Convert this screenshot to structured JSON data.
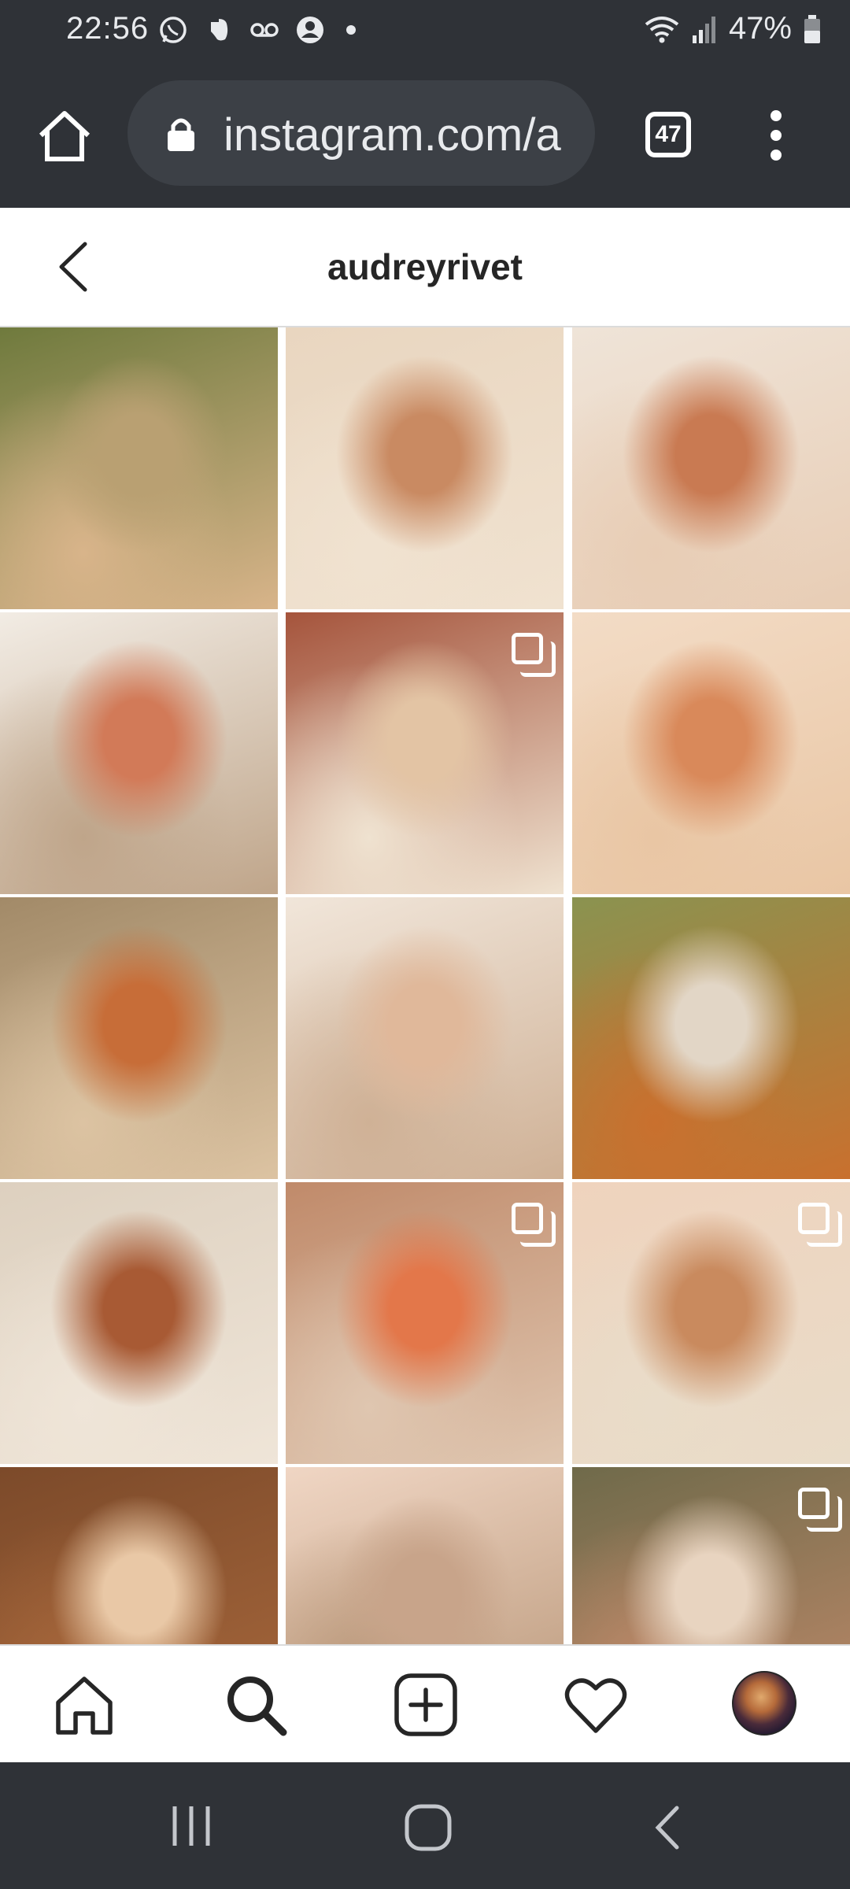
{
  "status_bar": {
    "time": "22:56",
    "battery": "47%",
    "left_icons": [
      "whatsapp-icon",
      "evernote-icon",
      "voicemail-icon",
      "account-icon",
      "dot-icon"
    ],
    "right_icons": [
      "wifi-icon",
      "signal-icon",
      "battery-icon"
    ]
  },
  "browser": {
    "url": "instagram.com/a",
    "tab_count": "47"
  },
  "profile": {
    "username": "audreyrivet"
  },
  "grid": {
    "posts": [
      {
        "multi": false,
        "colors": [
          "#6f7a3d",
          "#b9a072",
          "#d8b48a"
        ]
      },
      {
        "multi": false,
        "colors": [
          "#e9d6c0",
          "#c98a62",
          "#f0e2d0"
        ]
      },
      {
        "multi": false,
        "colors": [
          "#efe4d8",
          "#c97a52",
          "#e8cdb5"
        ]
      },
      {
        "multi": false,
        "colors": [
          "#f2ece4",
          "#d27a58",
          "#bfa58a"
        ]
      },
      {
        "multi": true,
        "colors": [
          "#a5543c",
          "#e3c4a4",
          "#efe2d0"
        ]
      },
      {
        "multi": false,
        "colors": [
          "#f3dcc6",
          "#d9895a",
          "#e9c6a4"
        ]
      },
      {
        "multi": false,
        "colors": [
          "#a28a68",
          "#c76d38",
          "#dcc3a2"
        ]
      },
      {
        "multi": false,
        "colors": [
          "#f1e6da",
          "#e0b89a",
          "#cfb196"
        ]
      },
      {
        "multi": false,
        "colors": [
          "#8a9350",
          "#e2d6c6",
          "#c9702e"
        ]
      },
      {
        "multi": false,
        "colors": [
          "#ddd0bf",
          "#a85a34",
          "#efe5d8"
        ]
      },
      {
        "multi": true,
        "colors": [
          "#c08a6a",
          "#e3774a",
          "#dfc6b0"
        ]
      },
      {
        "multi": true,
        "colors": [
          "#efd3bd",
          "#c98a5e",
          "#e9dcc9"
        ]
      },
      {
        "multi": false,
        "colors": [
          "#7c4a2a",
          "#e9c8a6",
          "#a8683c"
        ]
      },
      {
        "multi": false,
        "colors": [
          "#f0d6c4",
          "#c8a48a",
          "#b89678"
        ]
      },
      {
        "multi": true,
        "colors": [
          "#6f6a4a",
          "#e8d4c0",
          "#c08a6a"
        ]
      }
    ]
  },
  "bottom_nav": {
    "items": [
      "home-icon",
      "search-icon",
      "new-post-icon",
      "activity-icon",
      "profile-avatar"
    ]
  },
  "system_nav": {
    "items": [
      "recent-apps-icon",
      "home-circle-icon",
      "back-chevron-icon"
    ]
  }
}
